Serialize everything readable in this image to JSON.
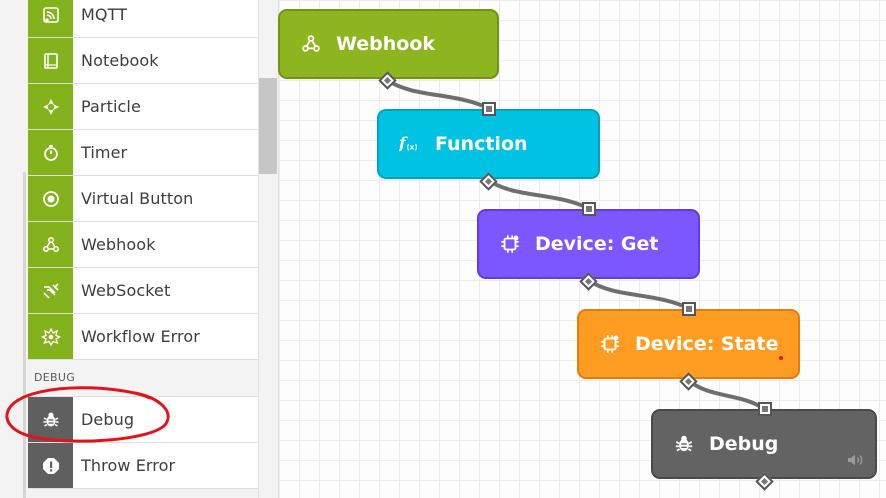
{
  "sidebar": {
    "trigger_items": [
      {
        "label": "MQTT",
        "icon": "rss-icon"
      },
      {
        "label": "Notebook",
        "icon": "notebook-icon"
      },
      {
        "label": "Particle",
        "icon": "particle-icon"
      },
      {
        "label": "Timer",
        "icon": "stopwatch-icon"
      },
      {
        "label": "Virtual Button",
        "icon": "radio-button-icon"
      },
      {
        "label": "Webhook",
        "icon": "webhook-icon"
      },
      {
        "label": "WebSocket",
        "icon": "websocket-icon"
      },
      {
        "label": "Workflow Error",
        "icon": "error-burst-icon"
      }
    ],
    "debug_section": {
      "header": "DEBUG",
      "items": [
        {
          "label": "Debug",
          "icon": "bug-icon"
        },
        {
          "label": "Throw Error",
          "icon": "exclamation-icon"
        }
      ]
    }
  },
  "canvas": {
    "nodes": [
      {
        "id": "webhook",
        "label": "Webhook",
        "icon": "webhook-icon",
        "color": "#8db51f"
      },
      {
        "id": "function",
        "label": "Function",
        "icon": "function-icon",
        "color": "#00c2e3"
      },
      {
        "id": "device_get",
        "label": "Device: Get",
        "icon": "device-chip-icon",
        "color": "#7c56ff"
      },
      {
        "id": "device_state",
        "label": "Device: State",
        "icon": "device-chip-icon",
        "color": "#ff9c21"
      },
      {
        "id": "debug",
        "label": "Debug",
        "icon": "bug-icon",
        "color": "#636363"
      }
    ]
  },
  "colors": {
    "trigger_green": "#84b21c",
    "debug_gray": "#5f5f5f",
    "annotation_red": "#e0141c",
    "connection_line": "#6e6e6e"
  }
}
